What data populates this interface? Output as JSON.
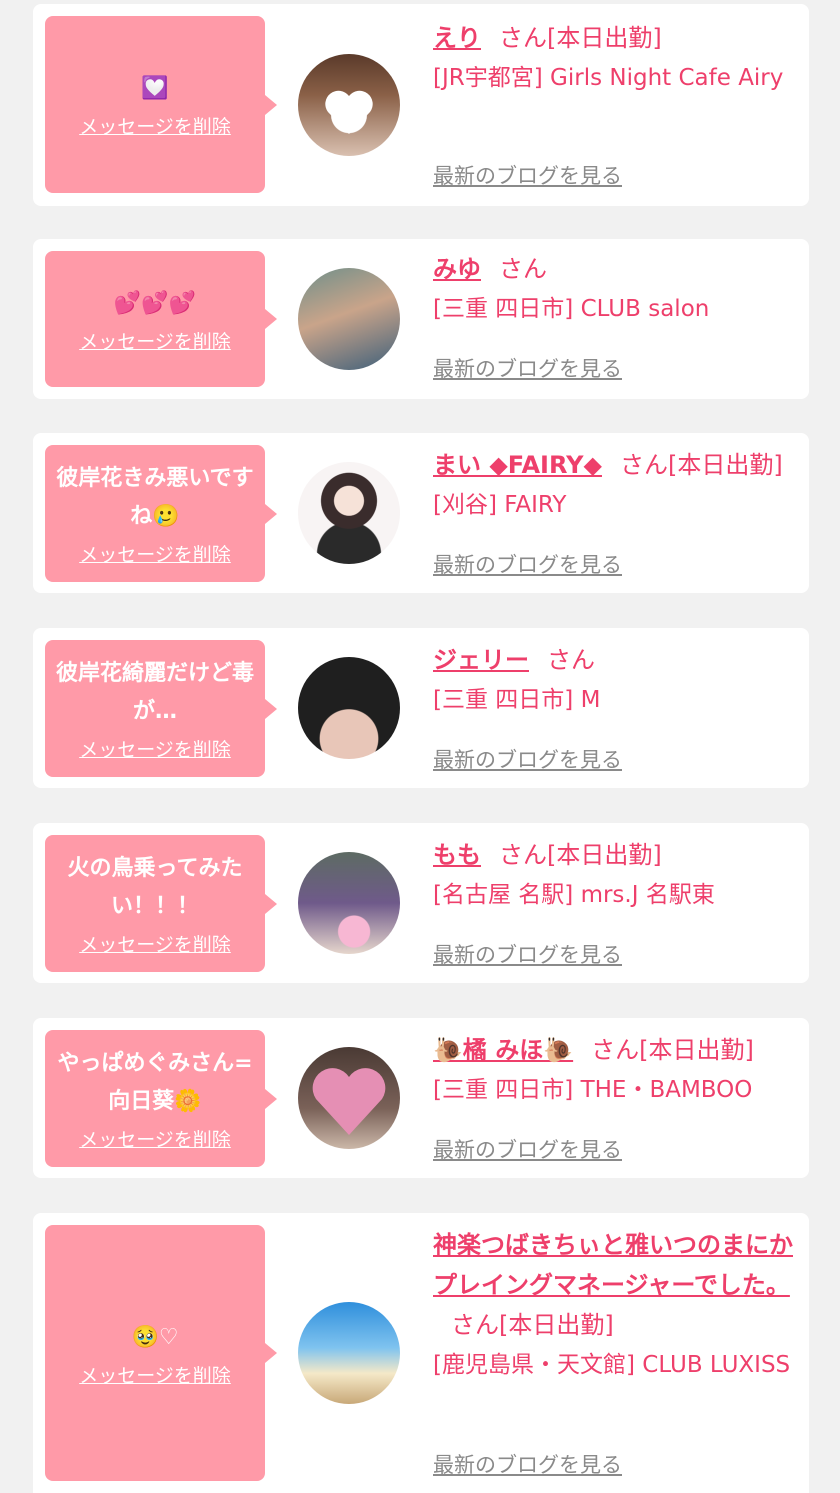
{
  "delete_label": "メッセージを削除",
  "blog_label": "最新のブログを見る",
  "san_label": "さん",
  "cards": [
    {
      "message": "💟",
      "name": "えり",
      "status": "[本日出勤]",
      "shop": "[JR宇都宮] Girls Night Cafe Airy"
    },
    {
      "message": "💕💕💕",
      "name": "みゆ",
      "status": "",
      "shop": "[三重 四日市] CLUB salon"
    },
    {
      "message": "彼岸花きみ悪いですね🥲",
      "name": "まい ◆FAIRY◆",
      "status": "[本日出勤]",
      "shop": "[刈谷] FAIRY"
    },
    {
      "message": "彼岸花綺麗だけど毒が…",
      "name": "ジェリー",
      "status": "",
      "shop": "[三重 四日市] M"
    },
    {
      "message": "火の鳥乗ってみたい！！！",
      "name": "もも",
      "status": "[本日出勤]",
      "shop": "[名古屋 名駅] mrs.J 名駅東"
    },
    {
      "message": "やっぱめぐみさん=向日葵🌼",
      "name": "🐌橘 みほ🐌",
      "status": "[本日出勤]",
      "shop": "[三重 四日市] THE・BAMBOO"
    },
    {
      "message": "🥹♡",
      "name": "神楽つばきちぃと雅いつのまにかプレイングマネージャーでした。",
      "status": "[本日出勤]",
      "shop": "[鹿児島県・天文館] CLUB LUXISS"
    }
  ]
}
